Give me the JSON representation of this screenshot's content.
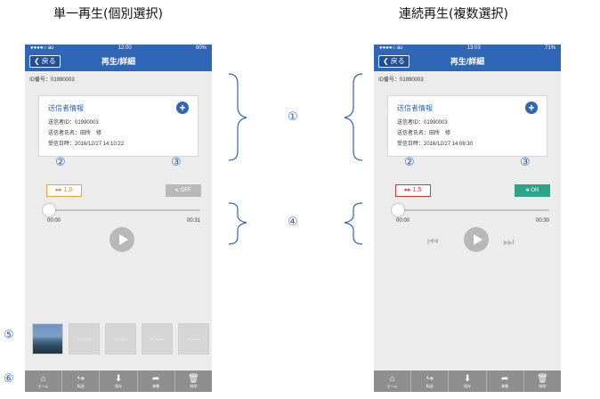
{
  "headings": {
    "left": "単一再生(個別選択)",
    "right": "連続再生(複数選択)"
  },
  "left_phone": {
    "status": {
      "carrier": "●●●●○ au",
      "time": "12:00",
      "battery": "80%"
    },
    "back_label": "戻る",
    "title": "再生/詳細",
    "id_line": "ID番号：01990003",
    "card": {
      "title": "送信者情報",
      "sender_id": "送信者ID：01990003",
      "sender_name": "送信者氏名：田所　修",
      "received_at": "受信日時：2016/12/27 14:10:22"
    },
    "speed": "▸▸ 1.0",
    "sound": "OFF",
    "time_start": "00:00",
    "time_end": "00:31",
    "thumb_placeholder": "NO IMAGE"
  },
  "right_phone": {
    "status": {
      "carrier": "●●●●○ au",
      "time": "13:03",
      "battery": "71%"
    },
    "back_label": "戻る",
    "title": "再生/詳細",
    "id_line": "ID番号：01990003",
    "card": {
      "title": "送信者情報",
      "sender_id": "送信者ID：01990003",
      "sender_name": "送信者氏名：田所　修",
      "received_at": "受信日時：2016/12/27 14:08:30"
    },
    "speed": "▸▸ 1.5",
    "sound": "ON",
    "time_start": "00:00",
    "time_end": "00:30"
  },
  "tabs": [
    "ホーム",
    "転送",
    "保存",
    "移動",
    "削除"
  ],
  "markers": [
    "①",
    "②",
    "③",
    "④",
    "⑤",
    "⑥"
  ],
  "colors": {
    "nav_blue": "#2f66b5",
    "speed_orange": "#e17a15",
    "speed_red": "#d8392e",
    "sound_on": "#2aa58a",
    "tabbar": "#8e8e8e"
  }
}
